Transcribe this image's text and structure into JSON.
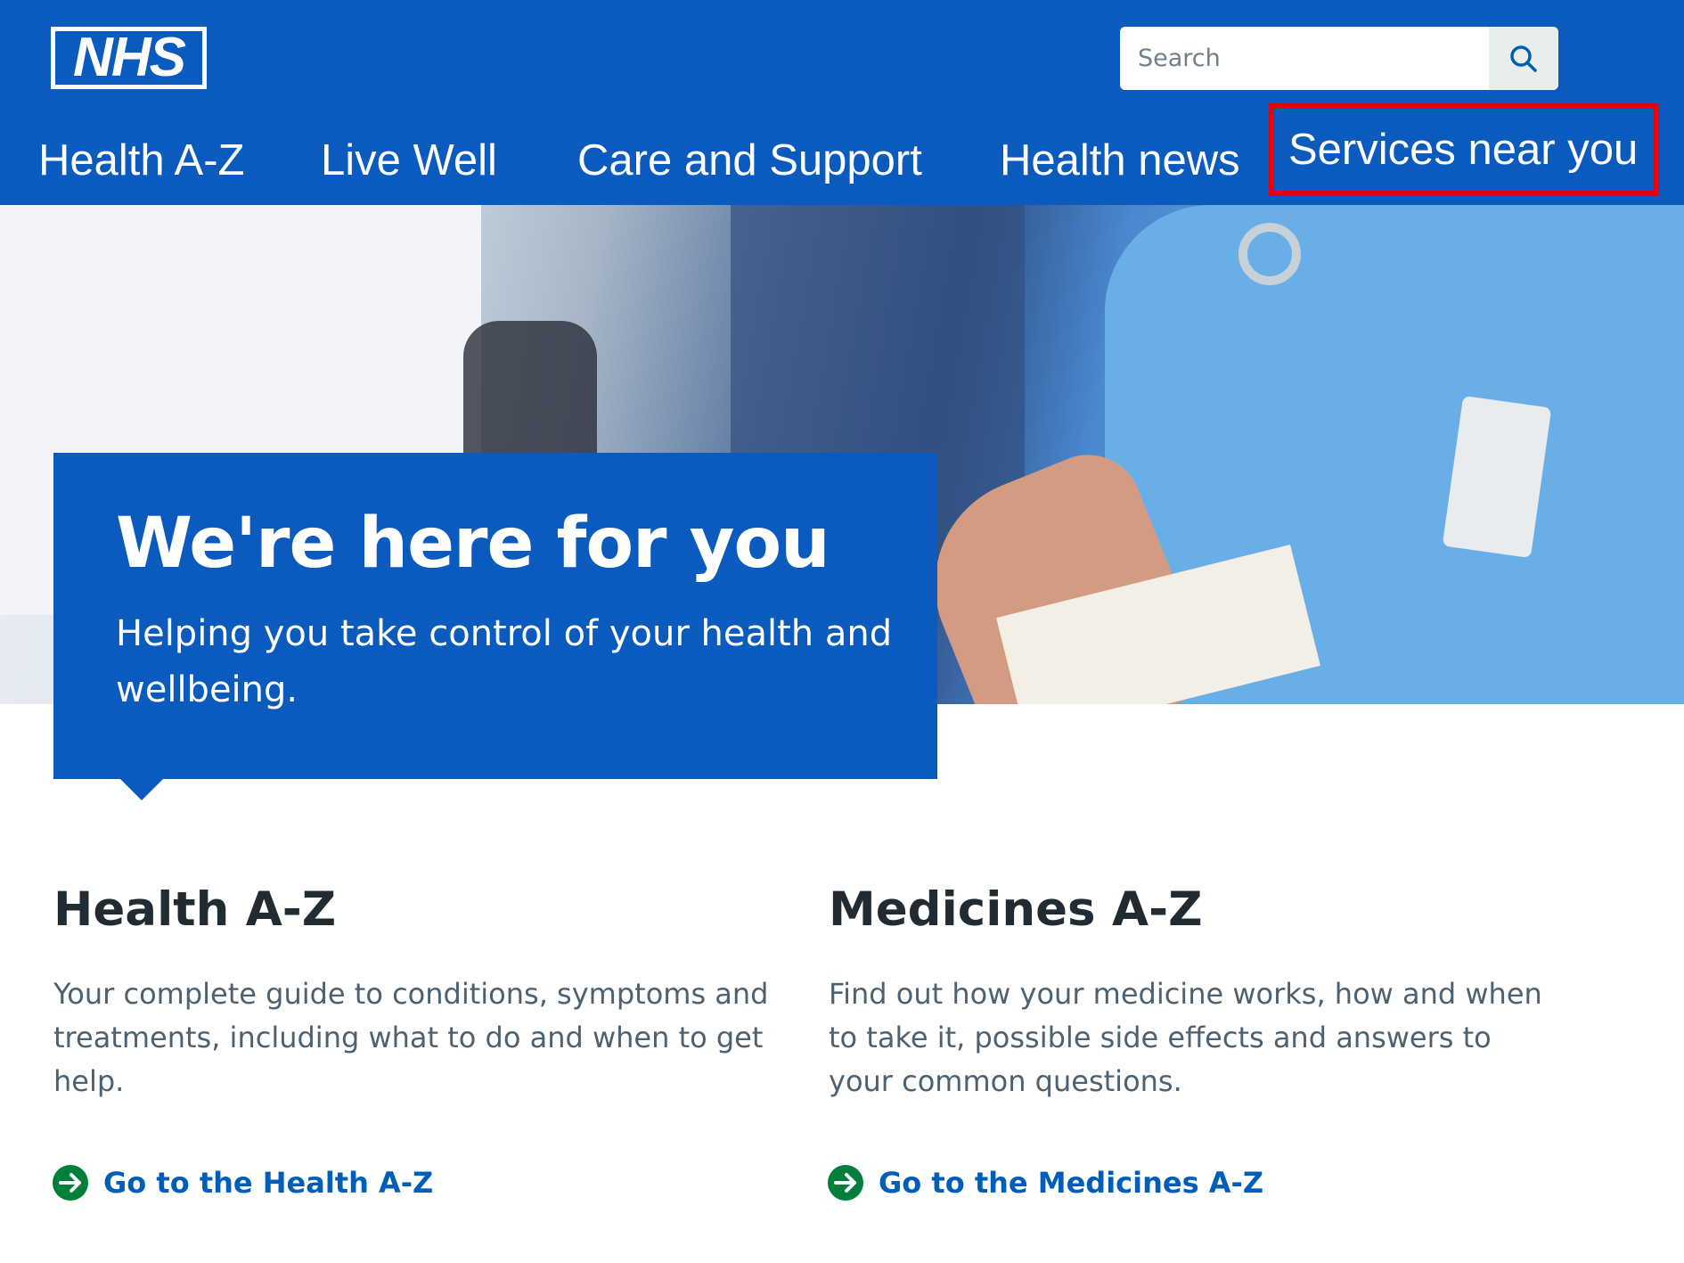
{
  "header": {
    "logo_text": "NHS",
    "search": {
      "placeholder": "Search",
      "button_icon": "search-icon"
    },
    "nav": [
      {
        "label": "Health A-Z"
      },
      {
        "label": "Live Well"
      },
      {
        "label": "Care and Support"
      },
      {
        "label": "Health news"
      },
      {
        "label": "Services near you",
        "highlighted": true
      }
    ]
  },
  "hero": {
    "title": "We're here for you",
    "subtitle": "Helping you take control of your health and wellbeing."
  },
  "cards": [
    {
      "title": "Health A-Z",
      "description": "Your complete guide to conditions, symptoms and treatments, including what to do and when to get help.",
      "link": "Go to the Health A-Z",
      "link_icon": "arrow-right-circle-icon"
    },
    {
      "title": "Medicines A-Z",
      "description": "Find out how your medicine works, how and when to take it, possible side effects and answers to your common questions.",
      "link": "Go to the Medicines A-Z",
      "link_icon": "arrow-right-circle-icon"
    }
  ],
  "colors": {
    "nhs_blue": "#0a5bbd",
    "highlight_border": "#e3000f",
    "link_blue": "#005eb8",
    "arrow_green": "#007f3b",
    "heading_text": "#212b32",
    "body_text": "#4c6272"
  }
}
